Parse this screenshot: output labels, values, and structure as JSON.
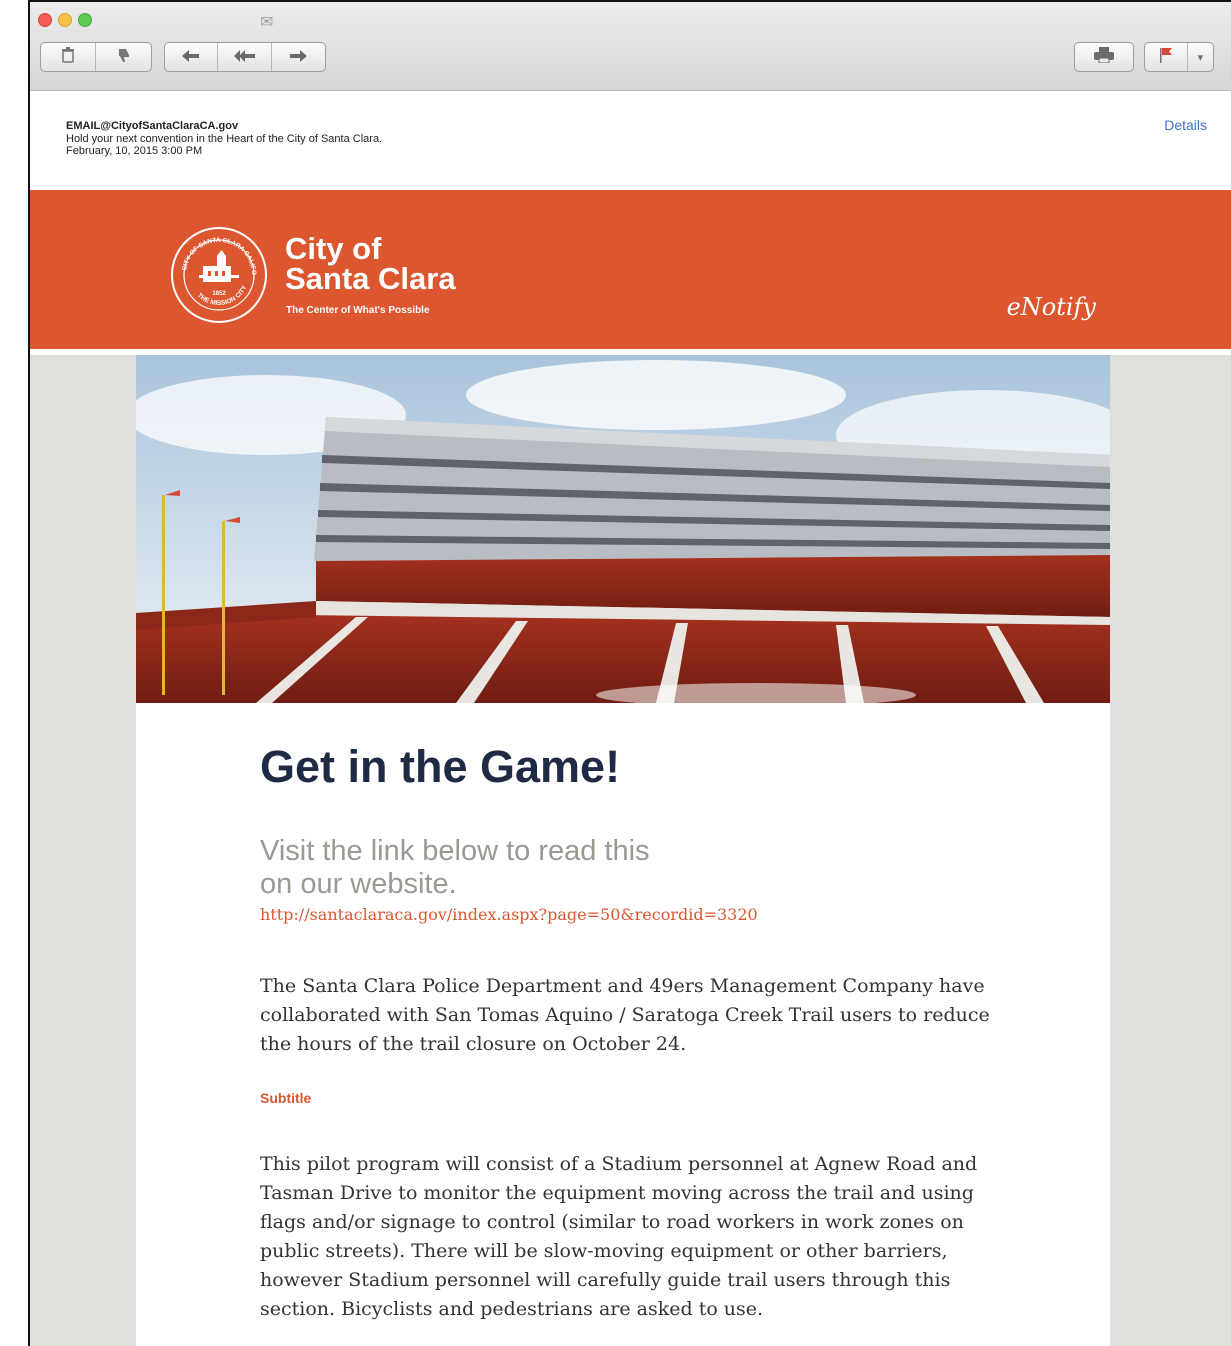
{
  "toolbar": {
    "icons": [
      "trash-icon",
      "junk-thumb-icon",
      "reply-icon",
      "reply-all-icon",
      "forward-icon",
      "print-icon",
      "flag-icon",
      "chevron-down-icon"
    ],
    "glyphs": {
      "trash": "🗑",
      "junk": "👎",
      "reply": "↩",
      "reply_all": "«",
      "forward": "➜",
      "print": "⎙",
      "flag": "⚑",
      "menu": "▾",
      "mail": "✉"
    }
  },
  "email": {
    "from": "EMAIL@CityofSantaClaraCA.gov",
    "subject": "Hold your next convention in the Heart of the City of Santa Clara.",
    "date": "February, 10, 2015  3:00 PM",
    "details_label": "Details"
  },
  "banner": {
    "city_line1": "City of",
    "city_line2": "Santa Clara",
    "tagline": "The Center of What's Possible",
    "enotify": "eNotify",
    "seal_top": "CITY OF SANTA CLARA CALIFORNIA",
    "seal_bottom": "THE MISSION CITY",
    "seal_year": "1852",
    "bg_color": "#dc5630"
  },
  "content": {
    "heading": "Get in the Game!",
    "lead_line1": "Visit the link below to read this",
    "lead_line2": "on our website.",
    "link": "http://santaclaraca.gov/index.aspx?page=50&recordid=3320",
    "paragraph1": "The Santa Clara Police Department and 49ers Management Company have collaborated with San Tomas Aquino / Saratoga Creek Trail users to reduce the hours of the trail closure on October 24.",
    "subtitle": "Subtitle",
    "paragraph2": "This pilot program will consist of a Stadium personnel at Agnew Road and Tasman Drive to monitor the equipment moving across the trail and using flags and/or signage to control (similar to road workers in work zones on public streets). There will be slow-moving equipment or other barriers, however Stadium personnel will carefully guide trail users through this section. Bicyclists and pedestrians are asked to use."
  },
  "colors": {
    "accent": "#dc5630",
    "heading": "#1f2a44",
    "link_blue": "#3f72c4",
    "page_bg": "#e1dfdc"
  }
}
